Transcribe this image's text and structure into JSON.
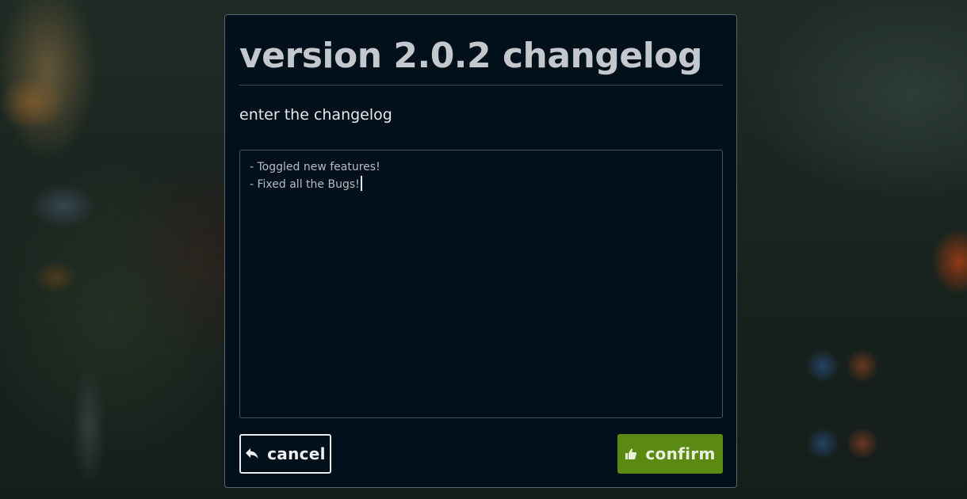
{
  "dialog": {
    "title": "version 2.0.2 changelog",
    "prompt": "enter the changelog",
    "changelog_lines": [
      "- Toggled new features!",
      "- Fixed all the Bugs!"
    ],
    "cancel_label": "cancel",
    "confirm_label": "confirm"
  },
  "icons": {
    "cancel": "reply-arrow-icon",
    "confirm": "thumbs-up-icon"
  },
  "colors": {
    "dialog_background": "#02101b",
    "title_text": "#c4c7cc",
    "confirm_button": "#5b8a12",
    "cancel_border": "#e8eaec"
  }
}
